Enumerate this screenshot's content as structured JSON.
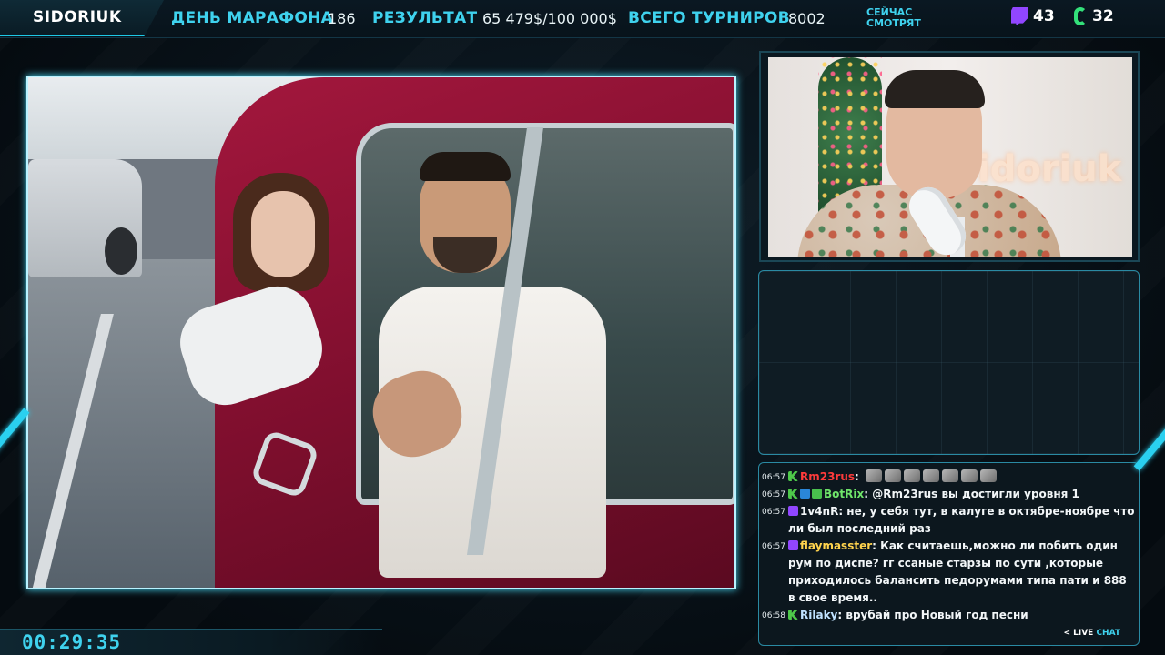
{
  "header": {
    "brand": "SIDORIUK",
    "marathon_day_label": "ДЕНЬ МАРАФОНА",
    "marathon_day_value": "186",
    "result_label": "РЕЗУЛЬТАТ",
    "result_value": "65 479$/100 000$",
    "tournaments_label": "ВСЕГО ТУРНИРОВ",
    "tournaments_value": "8002",
    "now_watching_label": "СЕЙЧАС СМОТРЯТ",
    "viewers": [
      {
        "platform_icon": "twitch-icon",
        "count": "43",
        "color": "#9146ff"
      },
      {
        "platform_icon": "kick-icon",
        "count": "32",
        "color": "#33e07a"
      }
    ]
  },
  "video": {
    "content": "music-video-red-car"
  },
  "webcam": {
    "background_neon": "idoriuk"
  },
  "chat": {
    "messages": [
      {
        "time": "06:57",
        "badges": [
          "kick"
        ],
        "user": "Rm23rus",
        "user_color": "#ff3b3b",
        "text": "",
        "emotes": 7
      },
      {
        "time": "06:57",
        "badges": [
          "kick",
          "mod",
          "verified"
        ],
        "user": "BotRix",
        "user_color": "#6fe46a",
        "text": "@Rm23rus вы достигли уровня 1",
        "emotes": 0
      },
      {
        "time": "06:57",
        "badges": [
          "twitch"
        ],
        "user": "1v4nR",
        "user_color": "#f2f6f8",
        "text": "не, у себя тут, в калуге в октябре-ноябре что ли был последний раз",
        "emotes": 0
      },
      {
        "time": "06:57",
        "badges": [
          "twitch"
        ],
        "user": "flaymasster",
        "user_color": "#ffd34d",
        "text": "Как считаешь,можно ли побить один рум по диспе? гг ссаные старзы по сути ,которые приходилось балансить педорумами типа пати и 888 в свое время..",
        "emotes": 0
      },
      {
        "time": "06:58",
        "badges": [
          "kick"
        ],
        "user": "Rilaky",
        "user_color": "#bfe1ff",
        "text": "врубай про Новый год песни",
        "emotes": 0
      }
    ],
    "live_chat_prefix": "< LIVE",
    "live_chat_suffix": "CHAT"
  },
  "timer": {
    "value": "00:29:35"
  },
  "colors": {
    "accent": "#3fd2ee",
    "background": "#07121a"
  }
}
